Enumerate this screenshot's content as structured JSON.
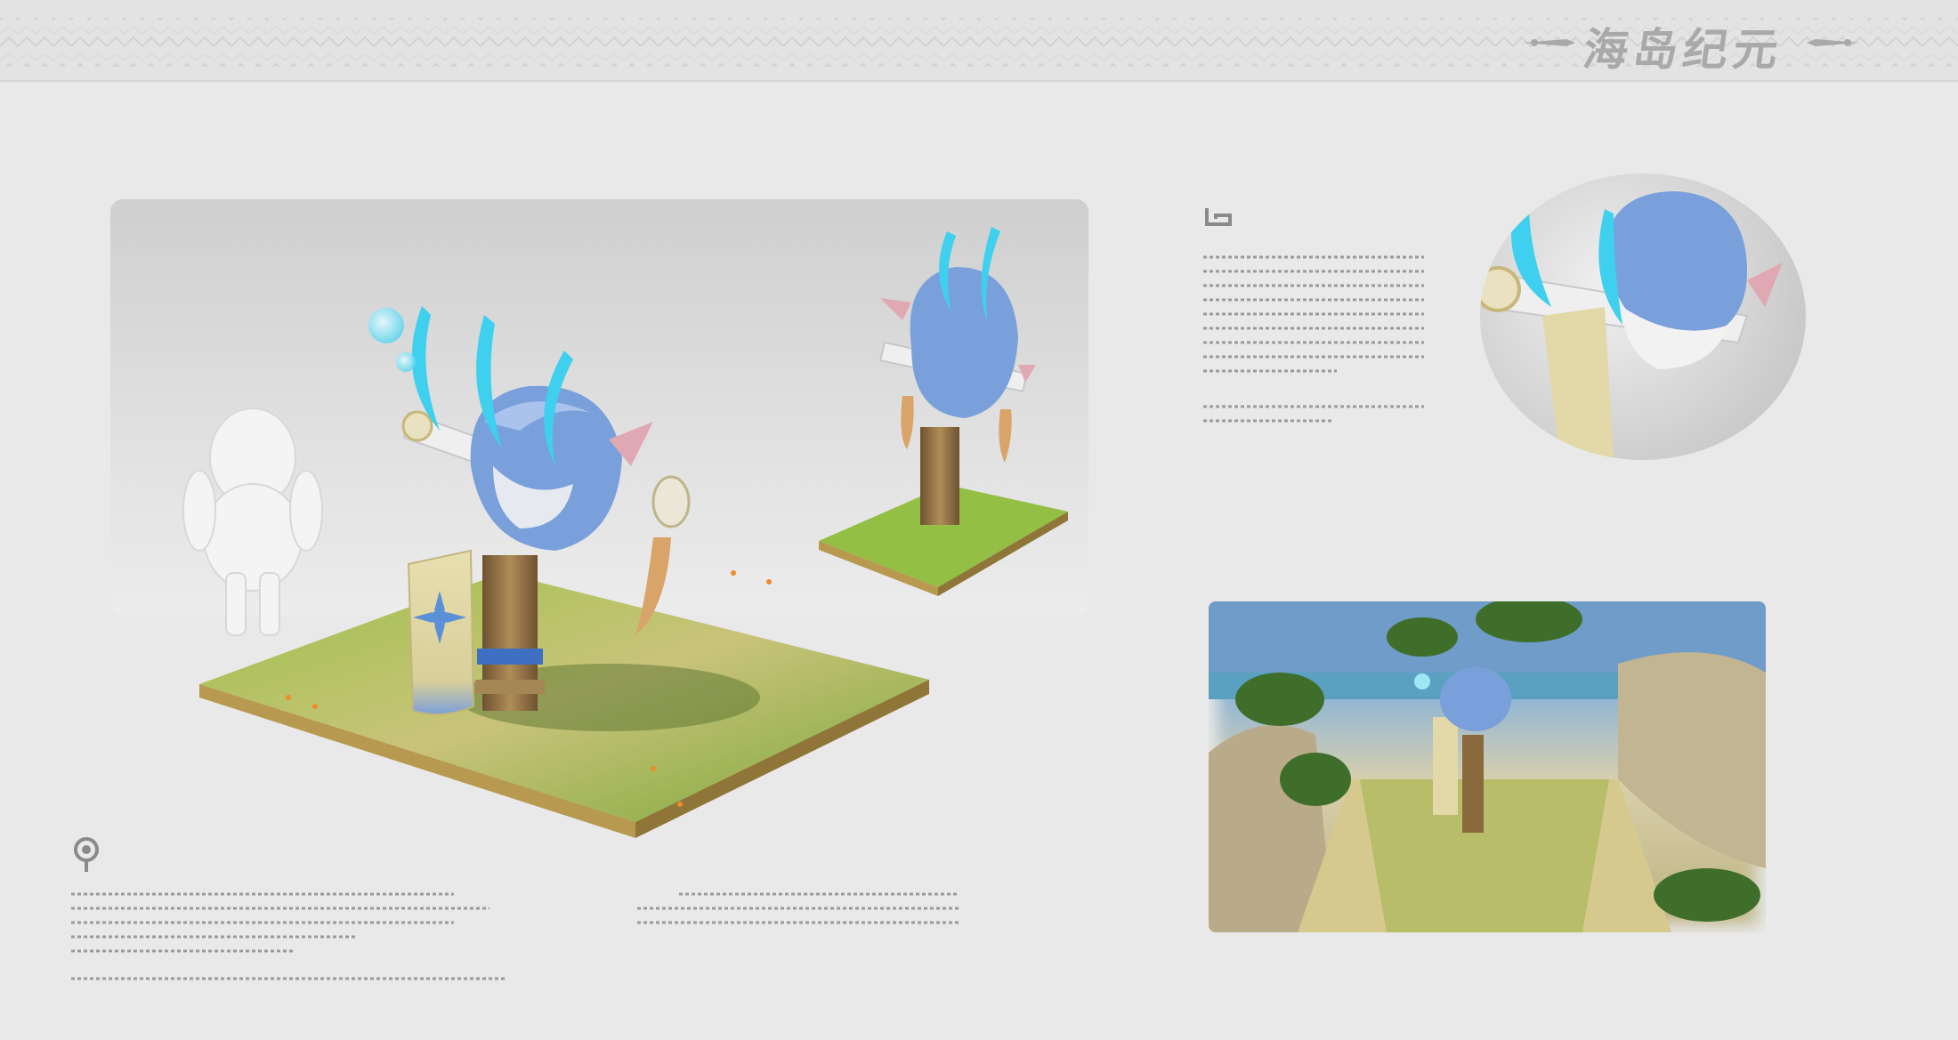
{
  "brand": {
    "logo_text": "海岛纪元"
  },
  "sections": {
    "section_b": {
      "marker_icon": "spiral-glyph-icon"
    },
    "section_a": {
      "marker_icon": "eye-glyph-icon"
    }
  },
  "colors": {
    "background": "#e9e9e9",
    "grass": "#86b23a",
    "totem_blue": "#6f97d6",
    "crystal_cyan": "#4fd6f0",
    "wood": "#8a6a3c"
  }
}
